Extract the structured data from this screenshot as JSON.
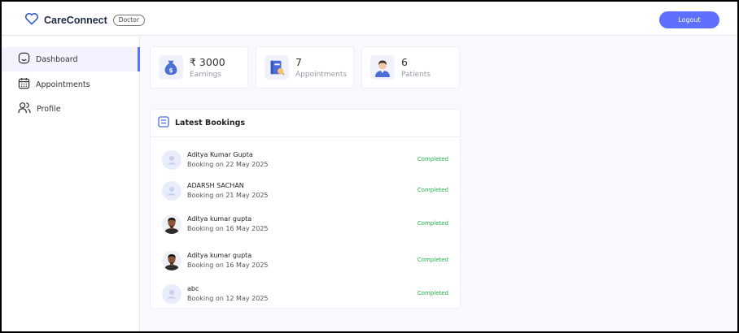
{
  "app": {
    "name": "CareConnect",
    "role_badge": "Doctor",
    "logout_label": "Logout",
    "accent_color": "#5f6fff"
  },
  "sidebar": {
    "items": [
      {
        "label": "Dashboard",
        "icon": "home-icon",
        "active": true
      },
      {
        "label": "Appointments",
        "icon": "calendar-icon",
        "active": false
      },
      {
        "label": "Profile",
        "icon": "people-icon",
        "active": false
      }
    ]
  },
  "stats": [
    {
      "value": "₹ 3000",
      "label": "Earnings",
      "icon": "money-bag-icon"
    },
    {
      "value": "7",
      "label": "Appointments",
      "icon": "appointment-book-icon"
    },
    {
      "value": "6",
      "label": "Patients",
      "icon": "patient-icon"
    }
  ],
  "latest_bookings": {
    "title": "Latest Bookings",
    "rows": [
      {
        "name": "Aditya Kumar Gupta",
        "date": "Booking on 22 May 2025",
        "status": "Completed",
        "avatar": "placeholder"
      },
      {
        "name": "ADARSH SACHAN",
        "date": "Booking on 21 May 2025",
        "status": "Completed",
        "avatar": "placeholder"
      },
      {
        "name": "Aditya kumar gupta",
        "date": "Booking on 16 May 2025",
        "status": "Completed",
        "avatar": "photo"
      },
      {
        "name": "Aditya kumar gupta",
        "date": "Booking on 16 May 2025",
        "status": "Completed",
        "avatar": "photo"
      },
      {
        "name": "abc",
        "date": "Booking on 12 May 2025",
        "status": "Completed",
        "avatar": "placeholder"
      }
    ],
    "status_color": "#22b24c"
  }
}
